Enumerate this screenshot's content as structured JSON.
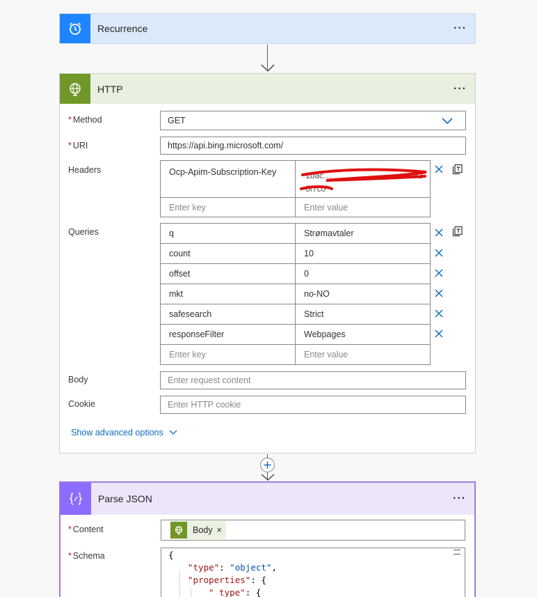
{
  "recurrence": {
    "title": "Recurrence",
    "more": "···"
  },
  "http": {
    "title": "HTTP",
    "more": "···",
    "method": {
      "label": "Method",
      "required_mark": "*",
      "value": "GET"
    },
    "uri": {
      "label": "URI",
      "required_mark": "*",
      "value": "https://api.bing.microsoft.com/"
    },
    "headers": {
      "label": "Headers",
      "rows": [
        {
          "key": "Ocp-Apim-Subscription-Key",
          "value": "[redacted]"
        }
      ],
      "key_placeholder": "Enter key",
      "value_placeholder": "Enter value"
    },
    "queries": {
      "label": "Queries",
      "rows": [
        {
          "key": "q",
          "value": "Strømavtaler"
        },
        {
          "key": "count",
          "value": "10"
        },
        {
          "key": "offset",
          "value": "0"
        },
        {
          "key": "mkt",
          "value": "no-NO"
        },
        {
          "key": "safesearch",
          "value": "Strict"
        },
        {
          "key": "responseFilter",
          "value": "Webpages"
        }
      ],
      "key_placeholder": "Enter key",
      "value_placeholder": "Enter value"
    },
    "body": {
      "label": "Body",
      "placeholder": "Enter request content"
    },
    "cookie": {
      "label": "Cookie",
      "placeholder": "Enter HTTP cookie"
    },
    "advanced_label": "Show advanced options"
  },
  "parse_json": {
    "title": "Parse JSON",
    "more": "···",
    "content": {
      "label": "Content",
      "required_mark": "*",
      "token_label": "Body",
      "token_remove": "×"
    },
    "schema": {
      "label": "Schema",
      "required_mark": "*",
      "lines": [
        {
          "text": "{"
        },
        {
          "key": "\"type\"",
          "sep": ": ",
          "val": "\"object\"",
          "end": ","
        },
        {
          "key": "\"properties\"",
          "sep": ": ",
          "val": "",
          "end": "{"
        },
        {
          "key": "\"_type\"",
          "sep": ": ",
          "val": "",
          "end": "{"
        }
      ]
    }
  },
  "colors": {
    "recurrence_accent": "#1f85ff",
    "http_accent": "#709727",
    "parse_json_accent": "#8c6cff",
    "link": "#0f6cbd"
  }
}
